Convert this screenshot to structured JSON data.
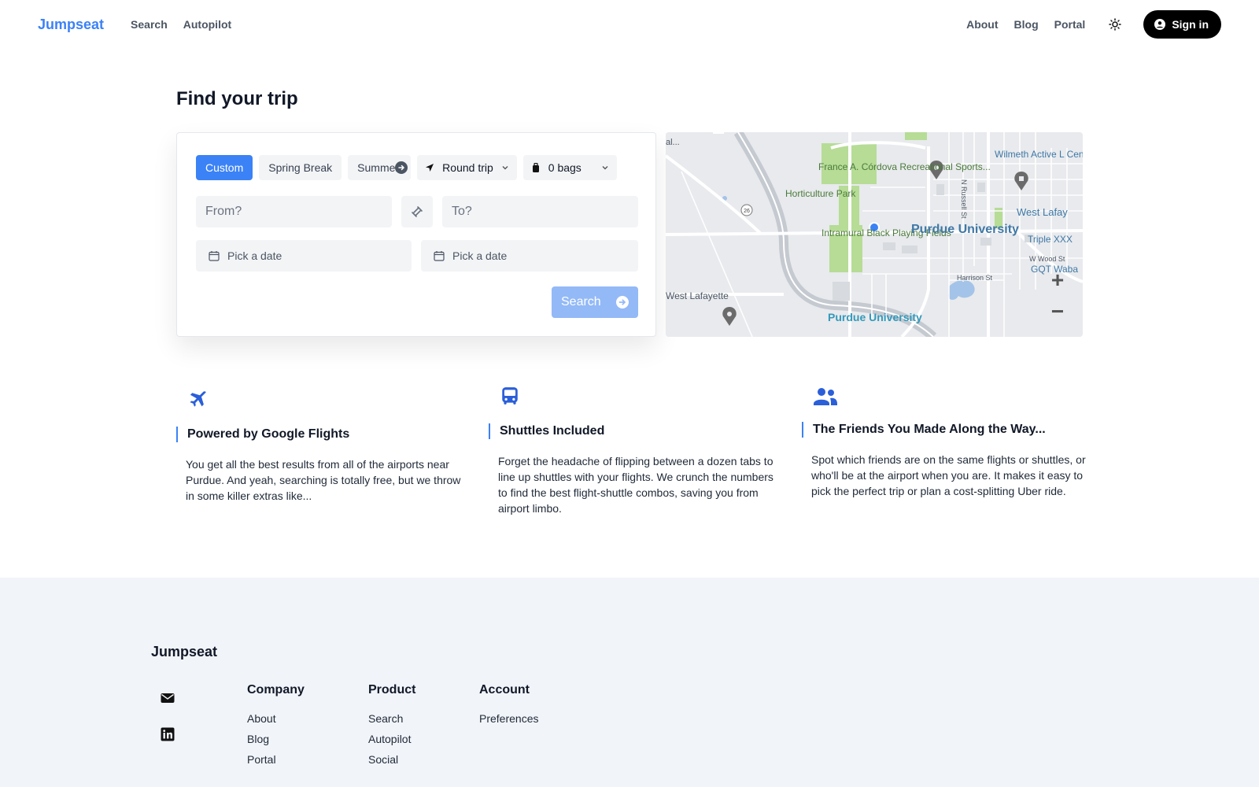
{
  "nav": {
    "brand": "Jumpseat",
    "left_links": [
      "Search",
      "Autopilot"
    ],
    "right_links": [
      "About",
      "Blog",
      "Portal"
    ],
    "theme_icon": "sun-icon",
    "signin_label": "Sign in"
  },
  "hero": {
    "title": "Find your trip",
    "tabs": [
      "Custom",
      "Spring Break",
      "Summer"
    ],
    "active_tab": "Custom",
    "trip_type": "Round trip",
    "bags": "0 bags",
    "from_placeholder": "From?",
    "to_placeholder": "To?",
    "depart_date_placeholder": "Pick a date",
    "return_date_placeholder": "Pick a date",
    "search_label": "Search"
  },
  "map": {
    "labels": {
      "campus": "Purdue University",
      "campus_south": "Purdue University",
      "horticulture": "Horticulture Park",
      "rec_sports": "France A. Córdova Recreational Sports...",
      "intramural": "Intramural Black Playing Fields",
      "west_lafayette": "West Lafayette",
      "west_lafayette_edge": "West Lafay",
      "wilmeth": "Wilmeth Active L Center (WALC)",
      "triple": "Triple XXX",
      "harrison": "Harrison St",
      "russell": "N Russell St",
      "wood": "W Wood St",
      "gqt": "GQT Waba",
      "route": "26",
      "top_left": "al..."
    },
    "zoom_in": "+",
    "zoom_out": "−"
  },
  "features": [
    {
      "icon": "airplane-icon",
      "title": "Powered by Google Flights",
      "body": "You get all the best results from all of the airports near Purdue. And yeah, searching is totally free, but we throw in some killer extras like..."
    },
    {
      "icon": "bus-icon",
      "title": "Shuttles Included",
      "body": "Forget the headache of flipping between a dozen tabs to line up shuttles with your flights. We crunch the numbers to find the best flight-shuttle combos, saving you from airport limbo."
    },
    {
      "icon": "users-icon",
      "title": "The Friends You Made Along the Way...",
      "body": "Spot which friends are on the same flights or shuttles, or who'll be at the airport when you are. It makes it easy to pick the perfect trip or plan a cost-splitting Uber ride."
    }
  ],
  "footer": {
    "brand": "Jumpseat",
    "socials": [
      "envelope-icon",
      "linkedin-icon"
    ],
    "columns": [
      {
        "heading": "Company",
        "links": [
          "About",
          "Blog",
          "Portal"
        ]
      },
      {
        "heading": "Product",
        "links": [
          "Search",
          "Autopilot",
          "Social"
        ]
      },
      {
        "heading": "Account",
        "links": [
          "Preferences"
        ]
      }
    ]
  },
  "colors": {
    "accent": "#3b82f6",
    "search_disabled": "#93b9f7",
    "footer_bg": "#f1f4f9",
    "map_green": "#a8d98a",
    "map_bg": "#e8eaed"
  }
}
